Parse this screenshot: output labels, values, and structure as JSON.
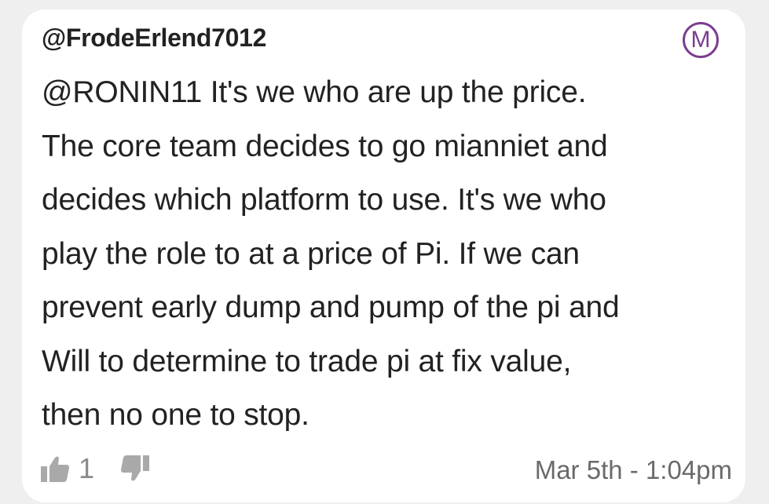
{
  "comment": {
    "username": "@FrodeErlend7012",
    "badge_letter": "M",
    "body_lines": [
      "@RONIN11 It's we who are up the price.",
      "The core team decides to go mianniet and",
      "decides which platform to use. It's we who",
      "play the role to at a price of Pi. If we can",
      "prevent early dump and pump of the pi and",
      "Will to determine to trade pi at fix value,",
      "then no one to stop."
    ],
    "like_count": "1",
    "timestamp": "Mar 5th - 1:04pm"
  },
  "icons": {
    "like": "thumbs-up-icon",
    "dislike": "thumbs-down-icon",
    "badge": "moderator-badge-icon"
  },
  "colors": {
    "badge": "#7b3d8f",
    "text": "#222222",
    "muted": "#8a8a8a"
  }
}
